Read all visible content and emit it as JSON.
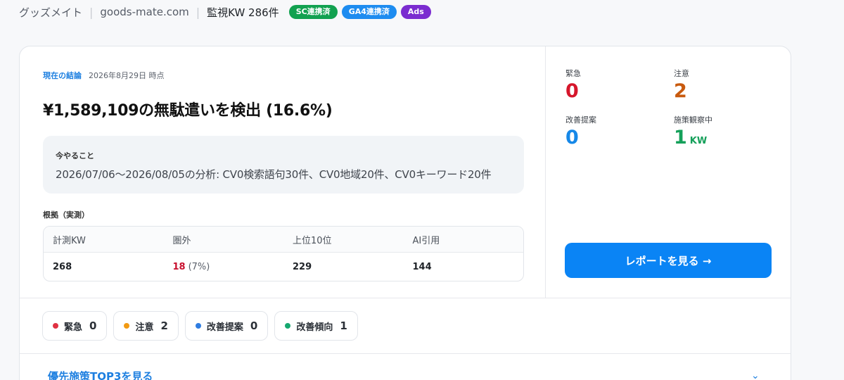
{
  "header": {
    "site_name": "グッズメイト",
    "domain": "goods-mate.com",
    "monitored": "監視KW 286件",
    "badges": [
      {
        "label": "SC連携済",
        "color": "#12a150"
      },
      {
        "label": "GA4連携済",
        "color": "#1d8cf0"
      },
      {
        "label": "Ads",
        "color": "#7b2cd0"
      }
    ]
  },
  "summary": {
    "label": "現在の結論",
    "date": "2026年8月29日 時点",
    "headline": "¥1,589,109の無駄遣いを検出 (16.6%)",
    "todo_title": "今やること",
    "todo_text": "2026/07/06〜2026/08/05の分析: CV0検索語句30件、CV0地域20件、CV0キーワード20件",
    "basis_title": "根拠（実測）",
    "table": {
      "headers": [
        "計測KW",
        "圏外",
        "上位10位",
        "AI引用"
      ],
      "values": [
        "268",
        "18",
        "229",
        "144"
      ],
      "out_pct": "(7%)"
    }
  },
  "stats": {
    "urgent": {
      "label": "緊急",
      "value": "0"
    },
    "caution": {
      "label": "注意",
      "value": "2"
    },
    "suggest": {
      "label": "改善提案",
      "value": "0"
    },
    "observing": {
      "label": "施策観察中",
      "value": "1",
      "unit": "KW"
    },
    "report_button": "レポートを見る →"
  },
  "chips": [
    {
      "label": "緊急",
      "count": "0",
      "color": "#e03142"
    },
    {
      "label": "注意",
      "count": "2",
      "color": "#f29a12"
    },
    {
      "label": "改善提案",
      "count": "0",
      "color": "#2f7de1"
    },
    {
      "label": "改善傾向",
      "count": "1",
      "color": "#16a870"
    }
  ],
  "top3_link": "優先施策TOP3を見る",
  "icons": {
    "chevron": "chevron-down-icon"
  }
}
